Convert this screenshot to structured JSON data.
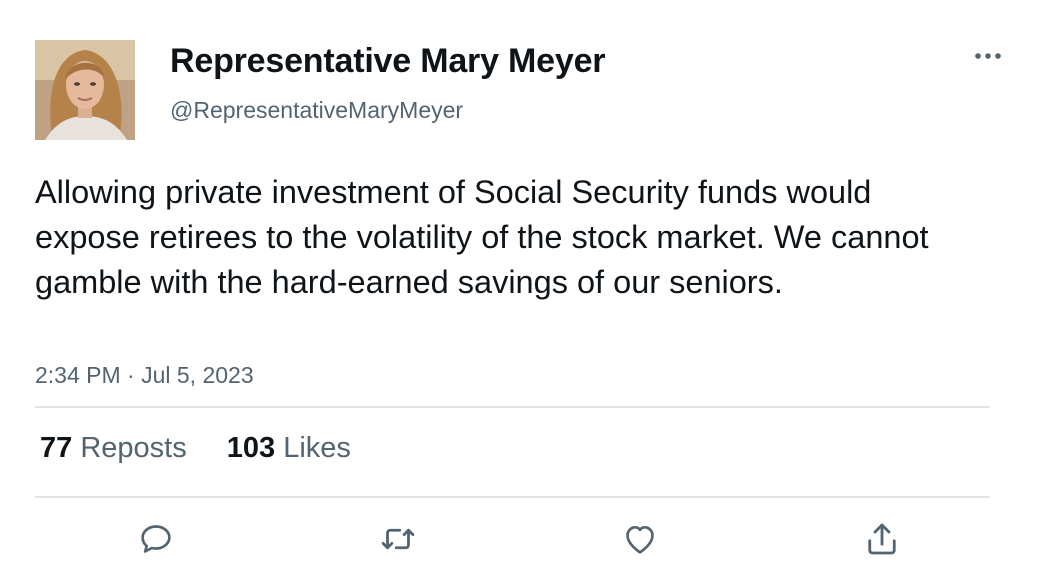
{
  "author": {
    "display_name": "Representative Mary Meyer",
    "handle": "@RepresentativeMaryMeyer",
    "avatar_icon": "profile-photo"
  },
  "tweet": {
    "text": "Allowing private investment of Social Security funds would expose retirees to the volatility of the stock market. We cannot gamble with the hard-earned savings of our seniors.",
    "timestamp": "2:34 PM · Jul 5, 2023"
  },
  "stats": {
    "reposts_count": "77",
    "reposts_label": "Reposts",
    "likes_count": "103",
    "likes_label": "Likes"
  },
  "actions": [
    {
      "name": "reply",
      "icon": "speech-bubble-icon"
    },
    {
      "name": "repost",
      "icon": "repost-arrows-icon"
    },
    {
      "name": "like",
      "icon": "heart-icon"
    },
    {
      "name": "share",
      "icon": "share-upload-icon"
    }
  ],
  "colors": {
    "text_primary": "#0f1419",
    "text_secondary": "#536471",
    "icon": "#536471",
    "divider": "#e1e4e7"
  }
}
